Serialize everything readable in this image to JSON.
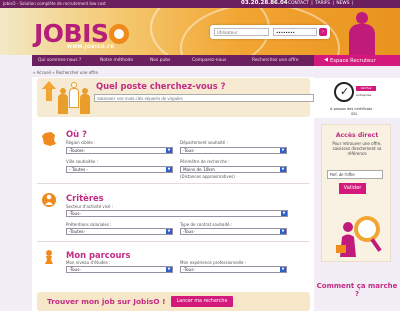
{
  "topbar": {
    "tagline": "JobisO - Solution complète de recrutement low cost",
    "phone": "03.20.28.86.04",
    "links": [
      "CONTACT",
      "TARIFS",
      "NEWS"
    ],
    "separator": "|"
  },
  "header": {
    "logo_text": "JOBIS",
    "logo_sub": "WWW.JOBISO.FR",
    "login_placeholder": "Utilisateur",
    "password_mask": "••••••••",
    "login_submit": "›"
  },
  "nav": {
    "items": [
      "Qui sommes-nous ?",
      "Notre méthode",
      "Nos pubs",
      "Comparez-nous",
      "Recherchez une offre"
    ],
    "espace_label": "Espace Recruteur",
    "espace_arrow": "◀"
  },
  "breadcrumb": "» Accueil » Rechercher une offre",
  "hero": {
    "title": "Quel poste cherchez-vous ?",
    "keyword_placeholder": "Saisissez vos mots clés séparés de virgules"
  },
  "ou": {
    "title": "Où ?",
    "region_label": "Région ciblée :",
    "region_value": "-Toutes-",
    "departement_label": "Département souhaité :",
    "departement_value": "-Tous-",
    "ville_label": "Ville souhaitée :",
    "ville_value": "- Toutes -",
    "perimetre_label": "Périmètre de recherche :",
    "perimetre_value": "Moins de 10km",
    "perimetre_hint": "(Distances approximatives)"
  },
  "criteres": {
    "title": "Critères",
    "secteur_label": "Secteur d'activité visé :",
    "secteur_value": "-Tous-",
    "pretentions_label": "Prétentions salariales :",
    "pretentions_value": "-Toutes-",
    "contrat_label": "Type de contrat souhaité :",
    "contrat_value": "-Tous-"
  },
  "parcours": {
    "title": "Mon parcours",
    "etudes_label": "Mon niveau d'études :",
    "etudes_value": "-Tous-",
    "experience_label": "Mon expérience professionnelle :",
    "experience_value": "-Tous-"
  },
  "cta": {
    "text": "Trouver mon job sur JobisO !",
    "button": "Lancer ma recherche"
  },
  "cert": {
    "badge_label": "Vérifiez",
    "badge_label2": "entreprise",
    "text": "A propos des certificats",
    "text2": "SSL"
  },
  "acces": {
    "title": "Accès direct",
    "text": "Pour retrouver une offre, saisissez directement sa référence",
    "input_value": "Ref. de l'offre",
    "button": "Valider"
  },
  "comment": "Comment ça marche ?",
  "colors": {
    "brand_pink": "#c22c85",
    "brand_orange": "#f2a532",
    "nav_purple": "#6b1f5e",
    "select_arrow": "#2f5ec7"
  },
  "icons": [
    "arrow-up-icon",
    "people-icon",
    "france-map-icon",
    "person-target-icon",
    "pawn-icon",
    "check-badge-icon",
    "search-person-illustration"
  ]
}
